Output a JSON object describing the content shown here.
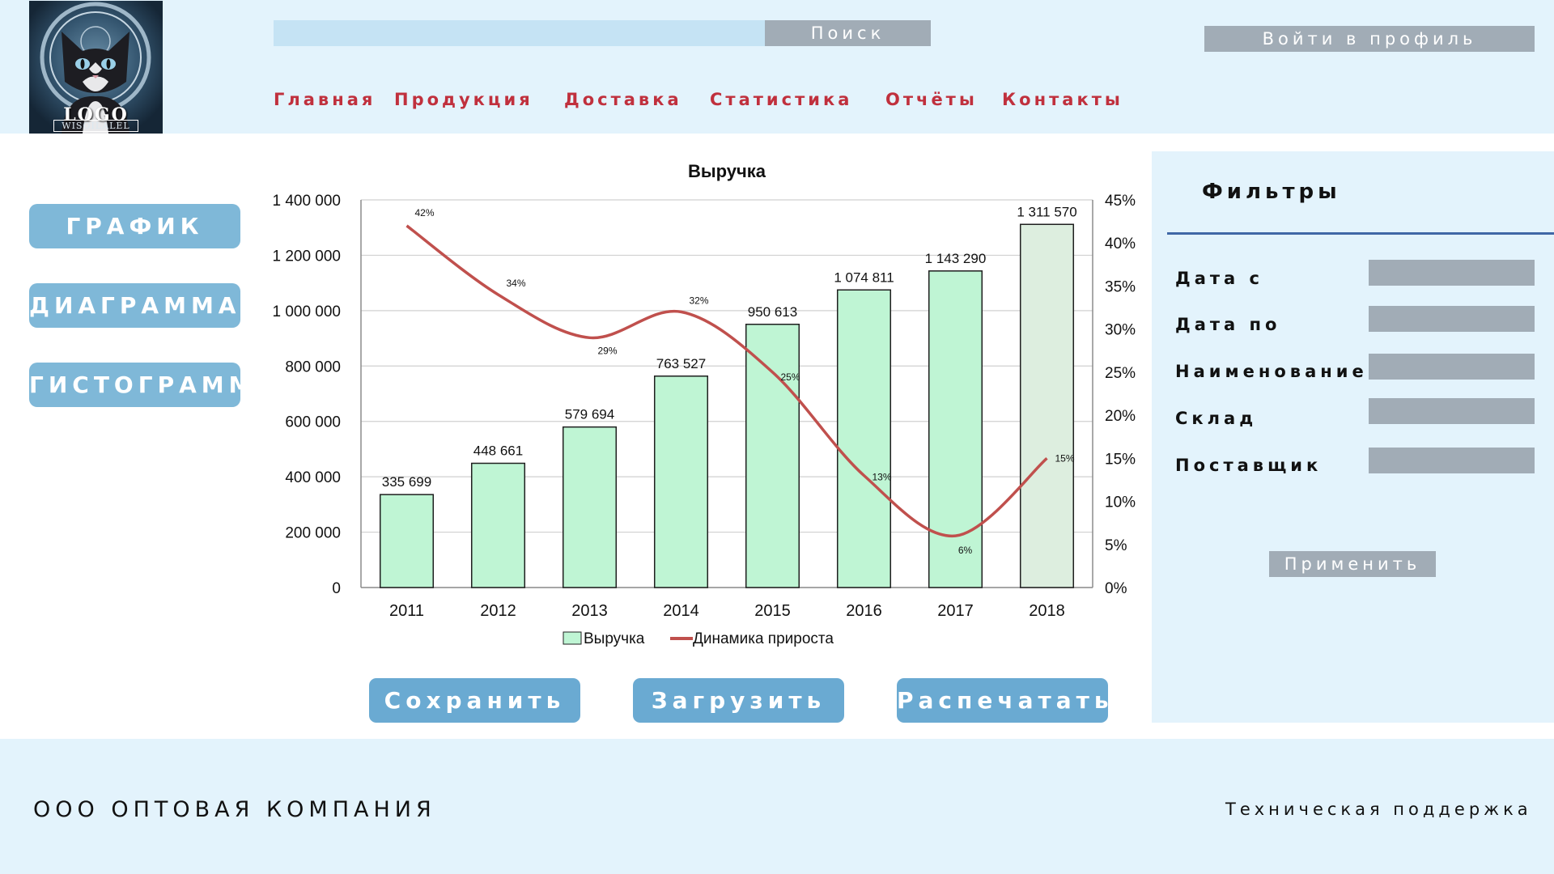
{
  "header": {
    "logo_text": "LOGO",
    "logo_subtext": "WISOILALEL",
    "search_button": "Поиск",
    "search_placeholder": "",
    "login_button": "Войти в профиль",
    "nav": [
      "Главная",
      "Продукция",
      "Доставка",
      "Статистика",
      "Отчёты",
      "Контакты"
    ]
  },
  "sidebar": {
    "buttons": [
      "ГРАФИК",
      "ДИАГРАММА",
      "ГИСТОГРАММА"
    ]
  },
  "actions": {
    "save": "Сохранить",
    "load": "Загрузить",
    "print": "Распечатать"
  },
  "filters": {
    "title": "Фильтры",
    "fields": [
      "Дата с",
      "Дата по",
      "Наименование",
      "Склад",
      "Поставщик"
    ],
    "apply": "Применить"
  },
  "footer": {
    "company": "ООО ОПТОВАЯ КОМПАНИЯ",
    "support": "Техническая поддержка"
  },
  "colors": {
    "accent_red": "#c0303d",
    "button_blue": "#7fb8d8",
    "panel_bg": "#e3f3fc",
    "bar_fill": "#bff5d4",
    "line": "#c0504d"
  },
  "chart_data": {
    "type": "bar",
    "title": "Выручка",
    "categories": [
      "2011",
      "2012",
      "2013",
      "2014",
      "2015",
      "2016",
      "2017",
      "2018"
    ],
    "series": [
      {
        "name": "Выручка",
        "type": "bar",
        "axis": "left",
        "values": [
          335699,
          448661,
          579694,
          763527,
          950613,
          1074811,
          1143290,
          1311570
        ],
        "labels": [
          "335 699",
          "448 661",
          "579 694",
          "763 527",
          "950 613",
          "1 074 811",
          "1 143 290",
          "1 311 570"
        ]
      },
      {
        "name": "Динамика прироста",
        "type": "line",
        "axis": "right",
        "values": [
          42,
          34,
          29,
          32,
          25,
          13,
          6,
          15
        ],
        "labels": [
          "42%",
          "34%",
          "29%",
          "32%",
          "25%",
          "13%",
          "6%",
          "15%"
        ]
      }
    ],
    "y_left": {
      "min": 0,
      "max": 1400000,
      "ticks": [
        "0",
        "200 000",
        "400 000",
        "600 000",
        "800 000",
        "1 000 000",
        "1 200 000",
        "1 400 000"
      ]
    },
    "y_right": {
      "min": 0,
      "max": 45,
      "ticks": [
        "0%",
        "5%",
        "10%",
        "15%",
        "20%",
        "25%",
        "30%",
        "35%",
        "40%",
        "45%"
      ]
    },
    "legend_position": "bottom",
    "grid": true
  }
}
